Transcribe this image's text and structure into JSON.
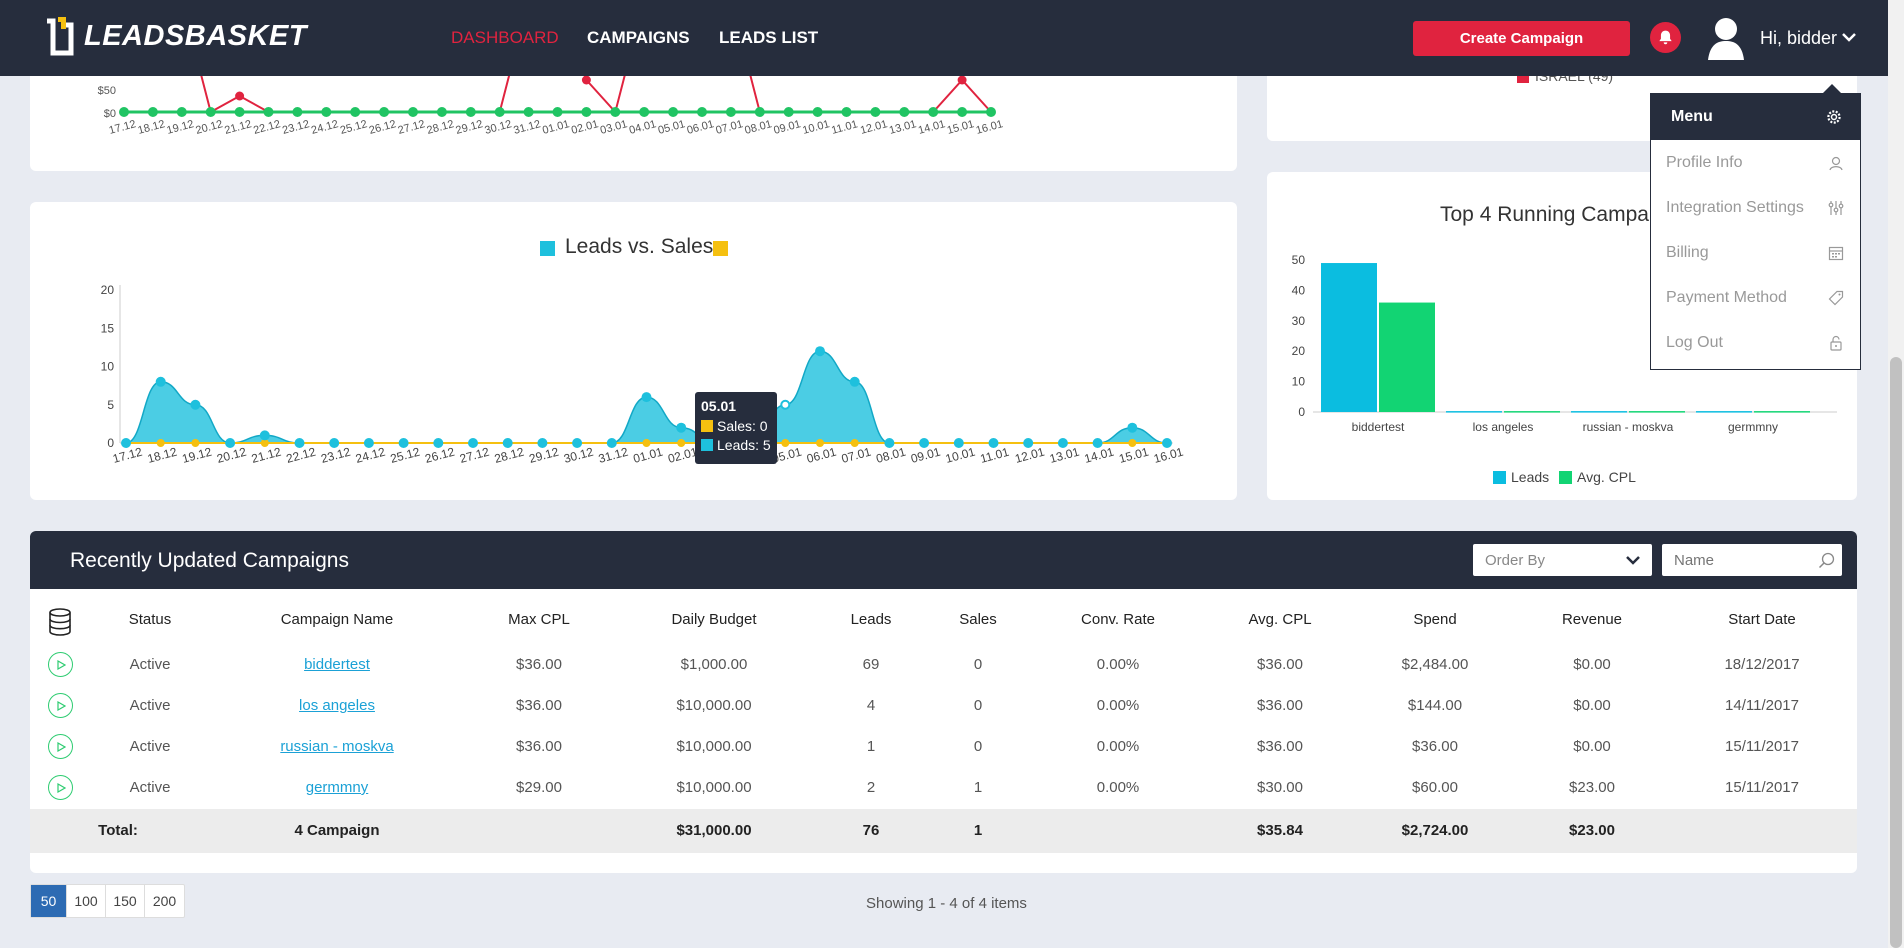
{
  "nav": {
    "brand": "LEADSBASKET",
    "items": [
      "DASHBOARD",
      "CAMPAIGNS",
      "LEADS LIST"
    ],
    "create_label": "Create Campaign",
    "greeting": "Hi, bidder"
  },
  "user_menu": {
    "title": "Menu",
    "items": [
      "Profile Info",
      "Integration Settings",
      "Billing",
      "Payment Method",
      "Log Out"
    ]
  },
  "top_chart": {
    "y_ticks": [
      "$50",
      "$0"
    ],
    "legend_partial": "ISRAEL (49)"
  },
  "dates": [
    "17.12",
    "18.12",
    "19.12",
    "20.12",
    "21.12",
    "22.12",
    "23.12",
    "24.12",
    "25.12",
    "26.12",
    "27.12",
    "28.12",
    "29.12",
    "30.12",
    "31.12",
    "01.01",
    "02.01",
    "03.01",
    "04.01",
    "05.01",
    "06.01",
    "07.01",
    "08.01",
    "09.01",
    "10.01",
    "11.01",
    "12.01",
    "13.01",
    "14.01",
    "15.01",
    "16.01"
  ],
  "chart_data": [
    {
      "type": "area",
      "title": "Leads vs. Sales",
      "x": [
        "17.12",
        "18.12",
        "19.12",
        "20.12",
        "21.12",
        "22.12",
        "23.12",
        "24.12",
        "25.12",
        "26.12",
        "27.12",
        "28.12",
        "29.12",
        "30.12",
        "31.12",
        "01.01",
        "02.01",
        "03.01",
        "04.01",
        "05.01",
        "06.01",
        "07.01",
        "08.01",
        "09.01",
        "10.01",
        "11.01",
        "12.01",
        "13.01",
        "14.01",
        "15.01",
        "16.01"
      ],
      "ylim": [
        0,
        20
      ],
      "yticks": [
        0,
        5,
        10,
        15,
        20
      ],
      "series": [
        {
          "name": "Leads",
          "color": "#1ec0dd",
          "values": [
            0,
            8,
            5,
            0,
            1,
            0,
            0,
            0,
            0,
            0,
            0,
            0,
            0,
            0,
            0,
            6,
            2,
            0,
            0,
            5,
            12,
            8,
            0,
            0,
            0,
            0,
            0,
            0,
            0,
            2,
            0
          ]
        },
        {
          "name": "Sales",
          "color": "#f5c010",
          "values": [
            0,
            0,
            0,
            0,
            0,
            0,
            0,
            0,
            0,
            0,
            0,
            0,
            0,
            0,
            0,
            0,
            0,
            0,
            0,
            0,
            0,
            0,
            0,
            0,
            0,
            0,
            0,
            0,
            0,
            0,
            0
          ]
        }
      ],
      "tooltip": {
        "title": "05.01",
        "sales": "Sales: 0",
        "leads": "Leads: 5"
      }
    },
    {
      "type": "bar",
      "title": "Top 4 Running Campai",
      "categories": [
        "biddertest",
        "los angeles",
        "russian - moskva",
        "germmny"
      ],
      "ylim": [
        0,
        50
      ],
      "yticks": [
        0,
        10,
        20,
        30,
        40,
        50
      ],
      "series": [
        {
          "name": "Leads",
          "color": "#0bbde0",
          "values": [
            49,
            0.3,
            0.3,
            0.3
          ]
        },
        {
          "name": "Avg. CPL",
          "color": "#12d473",
          "values": [
            36,
            0.3,
            0.3,
            0.3
          ]
        }
      ]
    }
  ],
  "table": {
    "title": "Recently Updated Campaigns",
    "order_by": "Order By",
    "name_placeholder": "Name",
    "headers": [
      "Status",
      "Campaign Name",
      "Max CPL",
      "Daily Budget",
      "Leads",
      "Sales",
      "Conv. Rate",
      "Avg. CPL",
      "Spend",
      "Revenue",
      "Start Date"
    ],
    "rows": [
      [
        "Active",
        "biddertest",
        "$36.00",
        "$1,000.00",
        "69",
        "0",
        "0.00%",
        "$36.00",
        "$2,484.00",
        "$0.00",
        "18/12/2017"
      ],
      [
        "Active",
        "los angeles",
        "$36.00",
        "$10,000.00",
        "4",
        "0",
        "0.00%",
        "$36.00",
        "$144.00",
        "$0.00",
        "14/11/2017"
      ],
      [
        "Active",
        "russian - moskva",
        "$36.00",
        "$10,000.00",
        "1",
        "0",
        "0.00%",
        "$36.00",
        "$36.00",
        "$0.00",
        "15/11/2017"
      ],
      [
        "Active",
        "germmny",
        "$29.00",
        "$10,000.00",
        "2",
        "1",
        "0.00%",
        "$30.00",
        "$60.00",
        "$23.00",
        "15/11/2017"
      ]
    ],
    "total": {
      "label": "Total:",
      "campaigns": "4 Campaign",
      "daily_budget": "$31,000.00",
      "leads": "76",
      "sales": "1",
      "avg_cpl": "$35.84",
      "spend": "$2,724.00",
      "revenue": "$23.00"
    }
  },
  "pagination": {
    "sizes": [
      "50",
      "100",
      "150",
      "200"
    ],
    "showing": "Showing 1 - 4 of 4 items"
  },
  "colors": {
    "navy": "#262d3d",
    "accent_red": "#e0233f",
    "cyan": "#1ec0dd",
    "green": "#12d473",
    "yellow": "#f5c010"
  }
}
